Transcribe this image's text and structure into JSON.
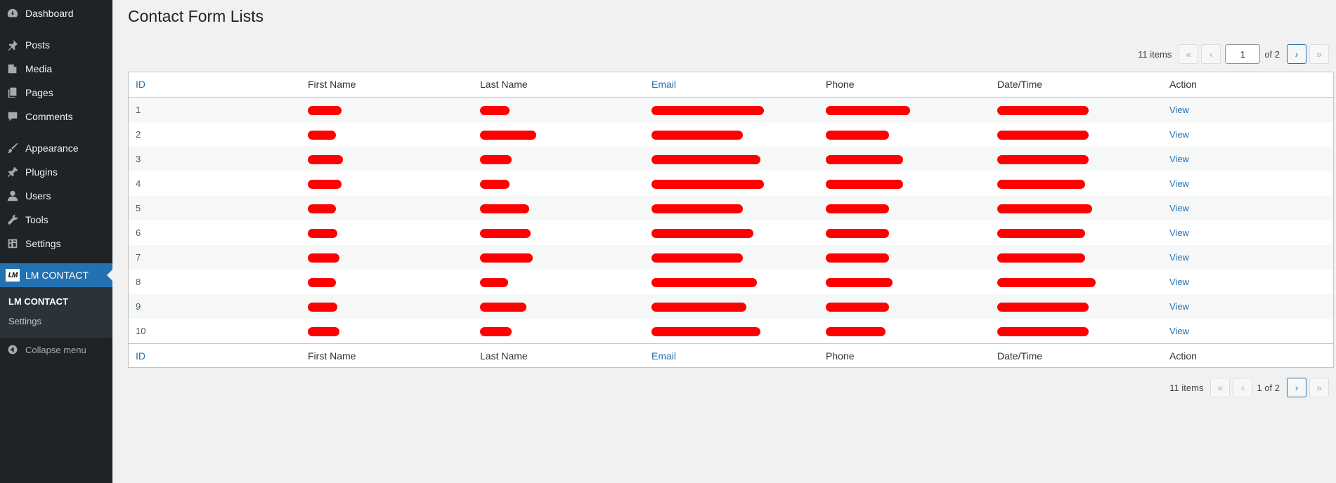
{
  "sidebar": {
    "items": [
      {
        "label": "Dashboard",
        "icon": "dashboard-icon"
      },
      {
        "label": "Posts",
        "icon": "pin-icon"
      },
      {
        "label": "Media",
        "icon": "media-icon"
      },
      {
        "label": "Pages",
        "icon": "pages-icon"
      },
      {
        "label": "Comments",
        "icon": "comment-icon"
      },
      {
        "label": "Appearance",
        "icon": "brush-icon"
      },
      {
        "label": "Plugins",
        "icon": "plugin-icon"
      },
      {
        "label": "Users",
        "icon": "user-icon"
      },
      {
        "label": "Tools",
        "icon": "wrench-icon"
      },
      {
        "label": "Settings",
        "icon": "settings-icon"
      }
    ],
    "active_plugin": {
      "label": "LM CONTACT",
      "icon": "lm-logo-icon",
      "logo_text": "LM"
    },
    "submenu": [
      {
        "label": "LM CONTACT"
      },
      {
        "label": "Settings"
      }
    ],
    "collapse_label": "Collapse menu"
  },
  "page": {
    "title": "Contact Form Lists"
  },
  "pagination": {
    "items_text": "11 items",
    "current_page": "1",
    "of_text": "of 2",
    "bottom_text": "1 of 2",
    "first_symbol": "«",
    "prev_symbol": "‹",
    "next_symbol": "›",
    "last_symbol": "»"
  },
  "table": {
    "columns": [
      "ID",
      "First Name",
      "Last Name",
      "Email",
      "Phone",
      "Date/Time",
      "Action"
    ],
    "action_label": "View",
    "rows": [
      {
        "id": "1"
      },
      {
        "id": "2"
      },
      {
        "id": "3"
      },
      {
        "id": "4"
      },
      {
        "id": "5"
      },
      {
        "id": "6"
      },
      {
        "id": "7"
      },
      {
        "id": "8"
      },
      {
        "id": "9"
      },
      {
        "id": "10"
      }
    ]
  },
  "colors": {
    "sidebar_bg": "#1d2327",
    "accent": "#2271b1",
    "redaction": "#ff0000"
  }
}
